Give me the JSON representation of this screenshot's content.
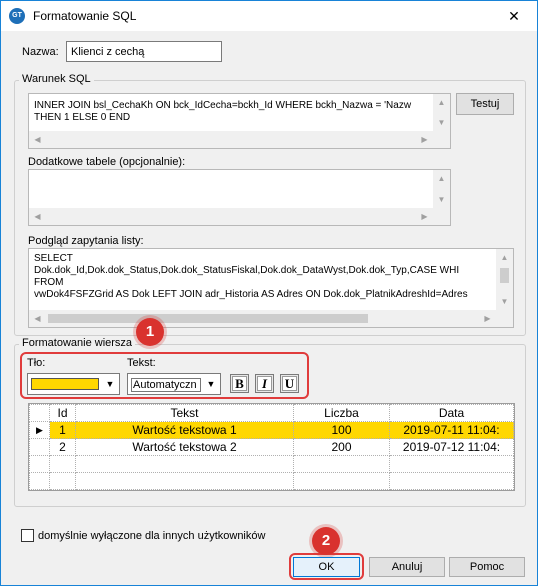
{
  "window": {
    "title": "Formatowanie SQL",
    "app_icon": "GT",
    "close": "✕"
  },
  "name": {
    "label": "Nazwa:",
    "value": "Klienci z cechą"
  },
  "condition": {
    "group_title": "Warunek SQL",
    "line1": "INNER JOIN bsl_CechaKh ON bck_IdCecha=bckh_Id WHERE bckh_Nazwa = 'Nazw",
    "line2": "THEN 1 ELSE 0 END",
    "test_button": "Testuj"
  },
  "extra_tables": {
    "label": "Dodatkowe tabele (opcjonalnie):",
    "value": ""
  },
  "preview": {
    "label": "Podgląd zapytania listy:",
    "lines": [
      "SELECT",
      "Dok.dok_Id,Dok.dok_Status,Dok.dok_StatusFiskal,Dok.dok_DataWyst,Dok.dok_Typ,CASE WHI",
      "FROM",
      "vwDok4FSFZGrid AS Dok LEFT JOIN adr_Historia AS Adres ON Dok.dok_PlatnikAdreshId=Adres"
    ]
  },
  "row_format": {
    "group_title": "Formatowanie wiersza",
    "bg_label": "Tło:",
    "bg_color": "#ffd700",
    "text_label": "Tekst:",
    "text_value": "Automatyczn",
    "bold": "B",
    "italic": "I",
    "underline": "U"
  },
  "table": {
    "headers": {
      "id": "Id",
      "text": "Tekst",
      "count": "Liczba",
      "date": "Data"
    },
    "rows": [
      {
        "id": "1",
        "text": "Wartość tekstowa 1",
        "count": "100",
        "date": "2019-07-11 11:04:"
      },
      {
        "id": "2",
        "text": "Wartość tekstowa 2",
        "count": "200",
        "date": "2019-07-12 11:04:"
      }
    ],
    "selected_marker": "▶"
  },
  "badges": {
    "one": "1",
    "two": "2"
  },
  "default_off": {
    "label": "domyślnie wyłączone dla innych użytkowników",
    "checked": false
  },
  "buttons": {
    "ok": "OK",
    "cancel": "Anuluj",
    "help": "Pomoc"
  },
  "colors": {
    "accent": "#1883d7",
    "highlight": "#e03c3c",
    "selection": "#ffd700"
  }
}
